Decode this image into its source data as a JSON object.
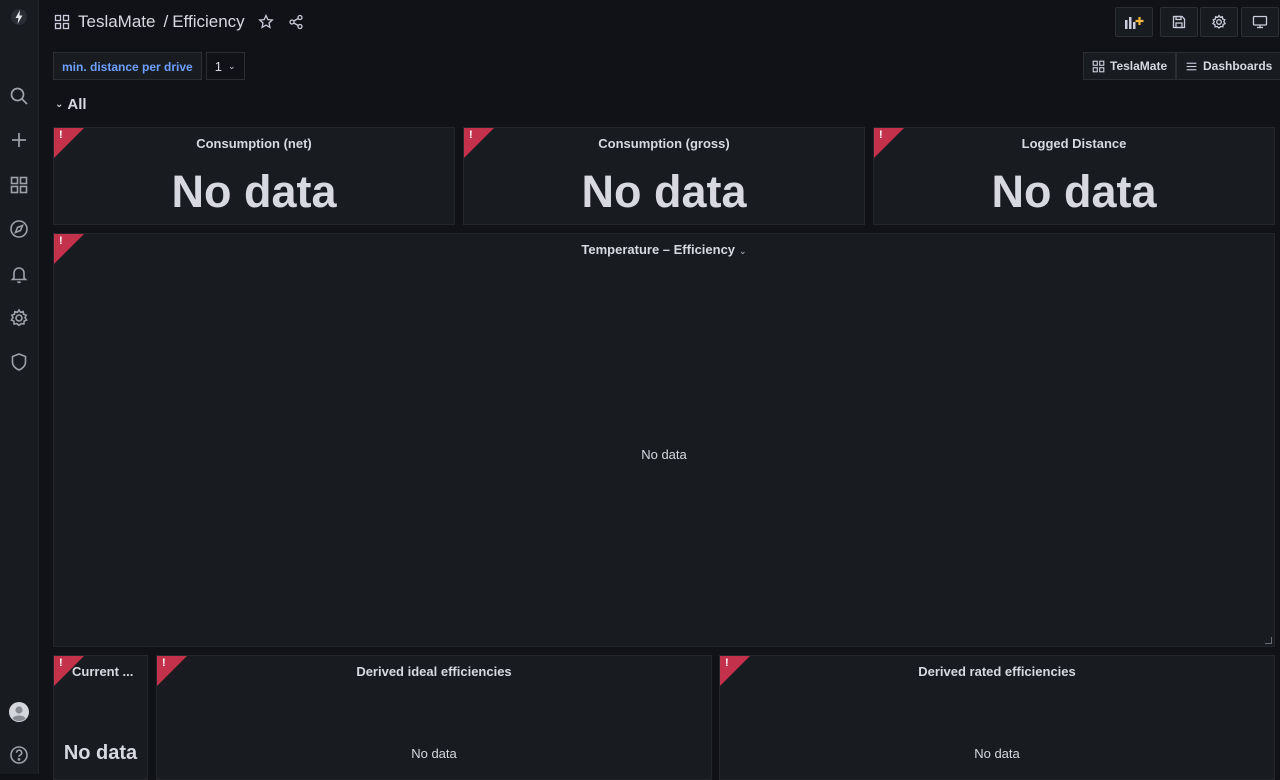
{
  "header": {
    "folder": "TeslaMate",
    "separator": "/",
    "title": "Efficiency"
  },
  "variables": {
    "label": "min. distance per drive",
    "value": "1"
  },
  "links": {
    "teslamate": "TeslaMate",
    "dashboards": "Dashboards"
  },
  "row": {
    "title": "All"
  },
  "panels": [
    {
      "title": "Consumption (net)",
      "status": "No data"
    },
    {
      "title": "Consumption (gross)",
      "status": "No data"
    },
    {
      "title": "Logged Distance",
      "status": "No data"
    },
    {
      "title": "Temperature – Efficiency",
      "status": "No data"
    },
    {
      "title": "Current ...",
      "status": "No data"
    },
    {
      "title": "Derived ideal efficiencies",
      "status": "No data"
    },
    {
      "title": "Derived rated efficiencies",
      "status": "No data"
    }
  ],
  "error_mark": "!",
  "colors": {
    "background": "#111217",
    "panel": "#181b1f",
    "error_corner": "#c4314b",
    "variable_label": "#6e9fff",
    "add_panel_accent": "#f5b73d"
  }
}
